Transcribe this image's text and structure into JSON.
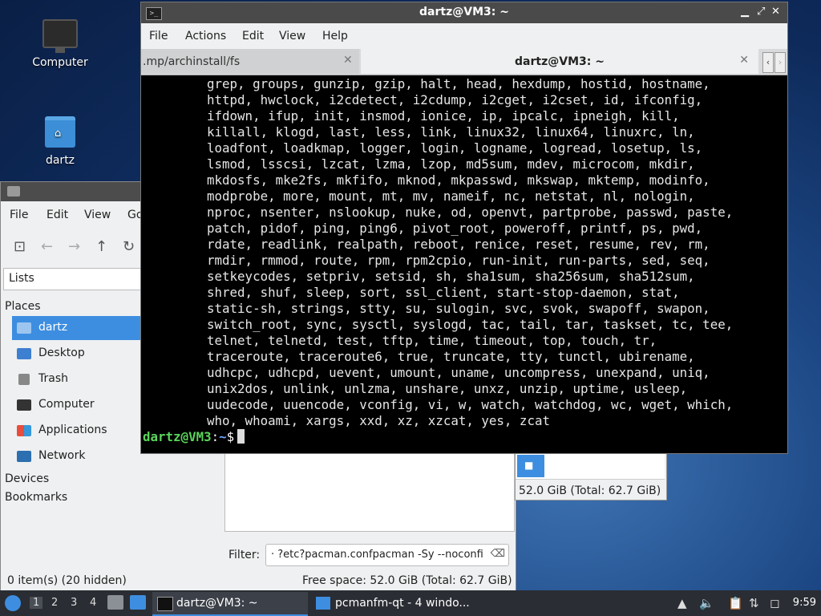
{
  "desktop": {
    "icons": [
      {
        "label": "Computer"
      },
      {
        "label": "dartz"
      }
    ]
  },
  "file_manager": {
    "menu": [
      "File",
      "Edit",
      "View",
      "Go"
    ],
    "side_pane_mode": "Lists",
    "places_heading": "Places",
    "places": [
      "dartz",
      "Desktop",
      "Trash",
      "Computer",
      "Applications",
      "Network"
    ],
    "devices_heading": "Devices",
    "bookmarks_heading": "Bookmarks",
    "filter_label": "Filter:",
    "filter_value": "· ?etc?pacman.confpacman -Sy --noconfi",
    "status_items": "0 item(s) (20 hidden)",
    "status_free": "Free space: 52.0 GiB (Total: 62.7 GiB)"
  },
  "file_manager2": {
    "free": "52.0 GiB (Total: 62.7 GiB)"
  },
  "terminal": {
    "title": "dartz@VM3: ~",
    "menu": [
      "File",
      "Actions",
      "Edit",
      "View",
      "Help"
    ],
    "tabs": [
      {
        "label": ".mp/archinstall/fs"
      },
      {
        "label": "dartz@VM3: ~"
      }
    ],
    "output": "grep, groups, gunzip, gzip, halt, head, hexdump, hostid, hostname,\nhttpd, hwclock, i2cdetect, i2cdump, i2cget, i2cset, id, ifconfig,\nifdown, ifup, init, insmod, ionice, ip, ipcalc, ipneigh, kill,\nkillall, klogd, last, less, link, linux32, linux64, linuxrc, ln,\nloadfont, loadkmap, logger, login, logname, logread, losetup, ls,\nlsmod, lsscsi, lzcat, lzma, lzop, md5sum, mdev, microcom, mkdir,\nmkdosfs, mke2fs, mkfifo, mknod, mkpasswd, mkswap, mktemp, modinfo,\nmodprobe, more, mount, mt, mv, nameif, nc, netstat, nl, nologin,\nnproc, nsenter, nslookup, nuke, od, openvt, partprobe, passwd, paste,\npatch, pidof, ping, ping6, pivot_root, poweroff, printf, ps, pwd,\nrdate, readlink, realpath, reboot, renice, reset, resume, rev, rm,\nrmdir, rmmod, route, rpm, rpm2cpio, run-init, run-parts, sed, seq,\nsetkeycodes, setpriv, setsid, sh, sha1sum, sha256sum, sha512sum,\nshred, shuf, sleep, sort, ssl_client, start-stop-daemon, stat,\nstatic-sh, strings, stty, su, sulogin, svc, svok, swapoff, swapon,\nswitch_root, sync, sysctl, syslogd, tac, tail, tar, taskset, tc, tee,\ntelnet, telnetd, test, tftp, time, timeout, top, touch, tr,\ntraceroute, traceroute6, true, truncate, tty, tunctl, ubirename,\nudhcpc, udhcpd, uevent, umount, uname, uncompress, unexpand, uniq,\nunix2dos, unlink, unlzma, unshare, unxz, unzip, uptime, usleep,\nuudecode, uuencode, vconfig, vi, w, watch, watchdog, wc, wget, which,\nwho, whoami, xargs, xxd, xz, xzcat, yes, zcat",
    "prompt_user": "dartz@VM3",
    "prompt_colon": ":",
    "prompt_path": "~",
    "prompt_symbol": "$"
  },
  "taskbar": {
    "workspaces": [
      "1",
      "2",
      "3",
      "4"
    ],
    "tasks": [
      {
        "label": "dartz@VM3: ~"
      },
      {
        "label": "pcmanfm-qt - 4 windo..."
      }
    ],
    "clock": "9:59"
  }
}
